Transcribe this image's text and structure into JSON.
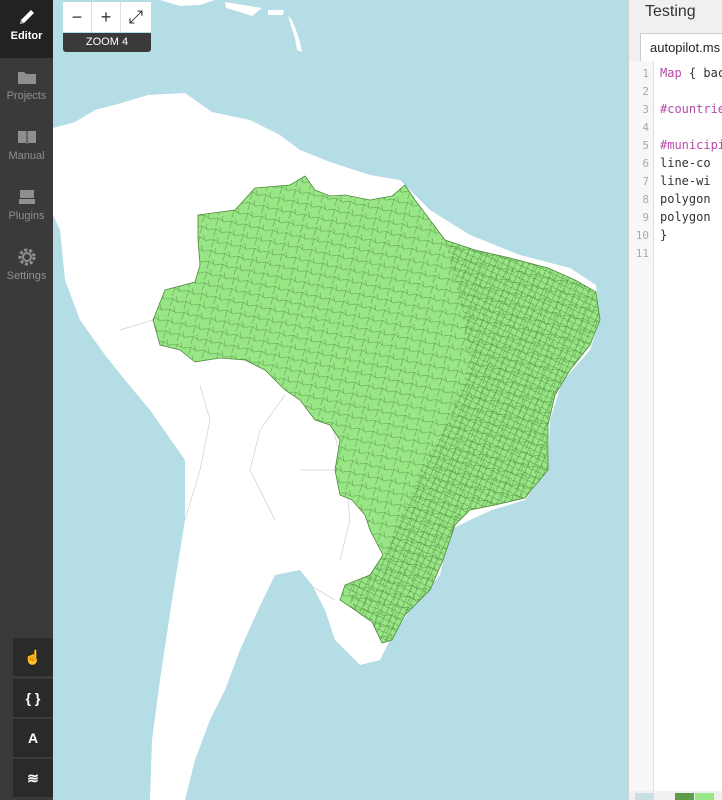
{
  "sidebar": {
    "items": [
      {
        "label": "Editor",
        "icon": "pencil-icon",
        "active": true
      },
      {
        "label": "Projects",
        "icon": "folder-icon"
      },
      {
        "label": "Manual",
        "icon": "book-icon"
      },
      {
        "label": "Plugins",
        "icon": "plugin-icon"
      },
      {
        "label": "Settings",
        "icon": "gear-icon"
      }
    ],
    "tools": [
      {
        "icon": "hand-icon",
        "glyph": "☝"
      },
      {
        "icon": "braces-icon",
        "glyph": "{ }"
      },
      {
        "icon": "font-icon",
        "glyph": "A"
      },
      {
        "icon": "layers-icon",
        "glyph": "≋"
      }
    ]
  },
  "map": {
    "zoom_out": "−",
    "zoom_in": "+",
    "fullscreen": "⤢",
    "zoom_label": "ZOOM 4",
    "colors": {
      "water": "#b4dde6",
      "land": "#ffffff",
      "municipalities": "#98e686",
      "lines": "#4f8a3c"
    }
  },
  "editor": {
    "title": "Testing",
    "tab": "autopilot.ms",
    "lines": [
      {
        "n": "1",
        "text": "Map { bac",
        "cls": "kw"
      },
      {
        "n": "2",
        "text": ""
      },
      {
        "n": "3",
        "text": "#countrie",
        "cls": "sel"
      },
      {
        "n": "4",
        "text": ""
      },
      {
        "n": "5",
        "text": "#municipi",
        "cls": "sel"
      },
      {
        "n": "6",
        "text": "  line-co"
      },
      {
        "n": "7",
        "text": "  line-wi"
      },
      {
        "n": "8",
        "text": "  polygon"
      },
      {
        "n": "9",
        "text": "  polygon"
      },
      {
        "n": "10",
        "text": "}"
      },
      {
        "n": "11",
        "text": ""
      }
    ],
    "swatches": [
      "#c9dfe4",
      "#f0f0f0",
      "#5c9c48",
      "#98e686"
    ]
  }
}
